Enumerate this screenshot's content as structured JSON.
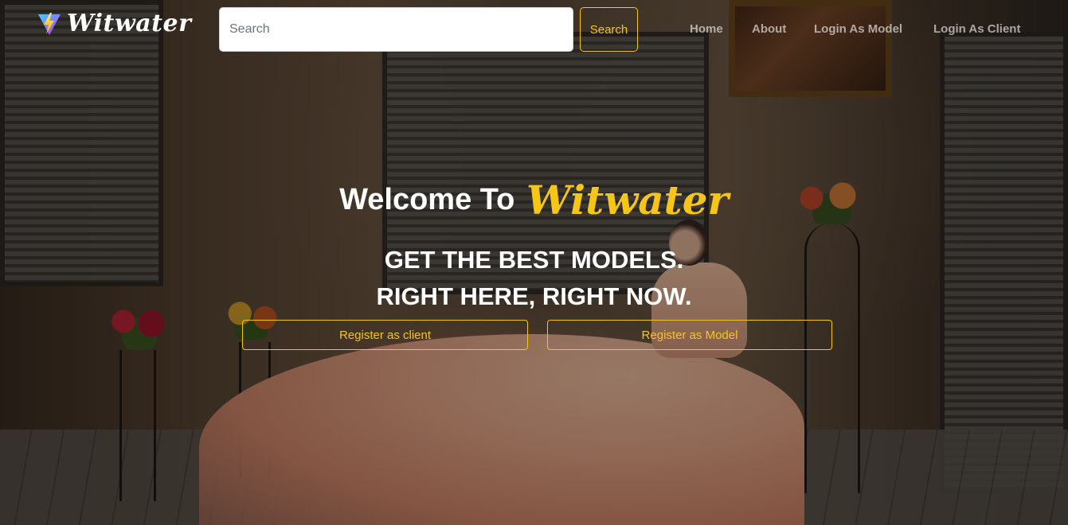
{
  "brand": {
    "name": "Witwater",
    "logo_icon": "lightning-bolt-logo-icon"
  },
  "search": {
    "placeholder": "Search",
    "value": "",
    "button_label": "Search"
  },
  "nav": {
    "items": [
      {
        "label": "Home"
      },
      {
        "label": "About"
      },
      {
        "label": "Login As Model"
      },
      {
        "label": "Login As Client"
      }
    ]
  },
  "hero": {
    "welcome": "Welcome To",
    "brand": "Witwater",
    "tagline_line1": "GET THE BEST MODELS.",
    "tagline_line2": "RIGHT HERE, RIGHT NOW.",
    "register_client_label": "Register as client",
    "register_model_label": "Register as Model"
  },
  "colors": {
    "accent": "#f5c518",
    "nav_text": "rgba(255,255,255,0.6)",
    "text": "#ffffff"
  }
}
